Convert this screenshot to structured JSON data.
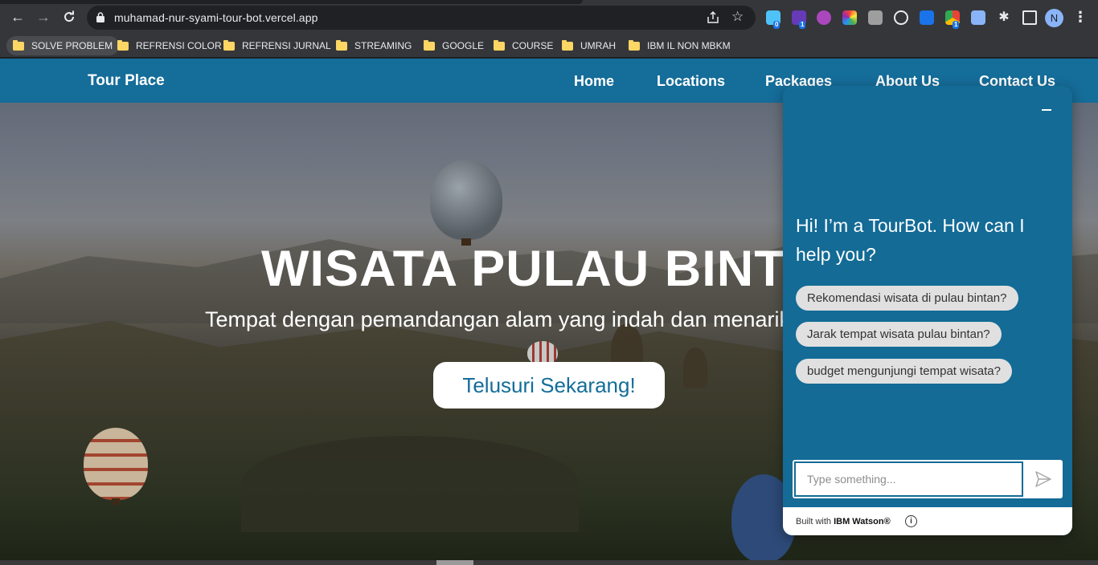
{
  "browser": {
    "url": "muhamad-nur-syami-tour-bot.vercel.app",
    "profile_initial": "N",
    "ext_badges": [
      "0",
      "1",
      "1"
    ],
    "bookmarks": [
      {
        "label": "SOLVE PROBLEM"
      },
      {
        "label": "REFRENSI COLOR"
      },
      {
        "label": "REFRENSI JURNAL"
      },
      {
        "label": "STREAMING"
      },
      {
        "label": "GOOGLE"
      },
      {
        "label": "COURSE"
      },
      {
        "label": "UMRAH"
      },
      {
        "label": "IBM IL NON MBKM"
      }
    ]
  },
  "site": {
    "brand": "Tour Place",
    "nav": [
      "Home",
      "Locations",
      "Packages",
      "About Us",
      "Contact Us"
    ],
    "hero_title": "WISATA PULAU BINTAN",
    "hero_subtitle": "Tempat dengan pemandangan alam yang indah dan menarik",
    "cta_label": "Telusuri Sekarang!",
    "nav_color": "#156d99"
  },
  "chatbot": {
    "greeting": "Hi! I’m a TourBot. How can I help you?",
    "suggestions": [
      "Rekomendasi wisata di pulau bintan?",
      "Jarak tempat wisata pulau bintan?",
      "budget mengunjungi tempat wisata?"
    ],
    "input_placeholder": "Type something...",
    "footer_prefix": "Built with ",
    "footer_brand": "IBM Watson®",
    "header_color": "#136b96"
  }
}
